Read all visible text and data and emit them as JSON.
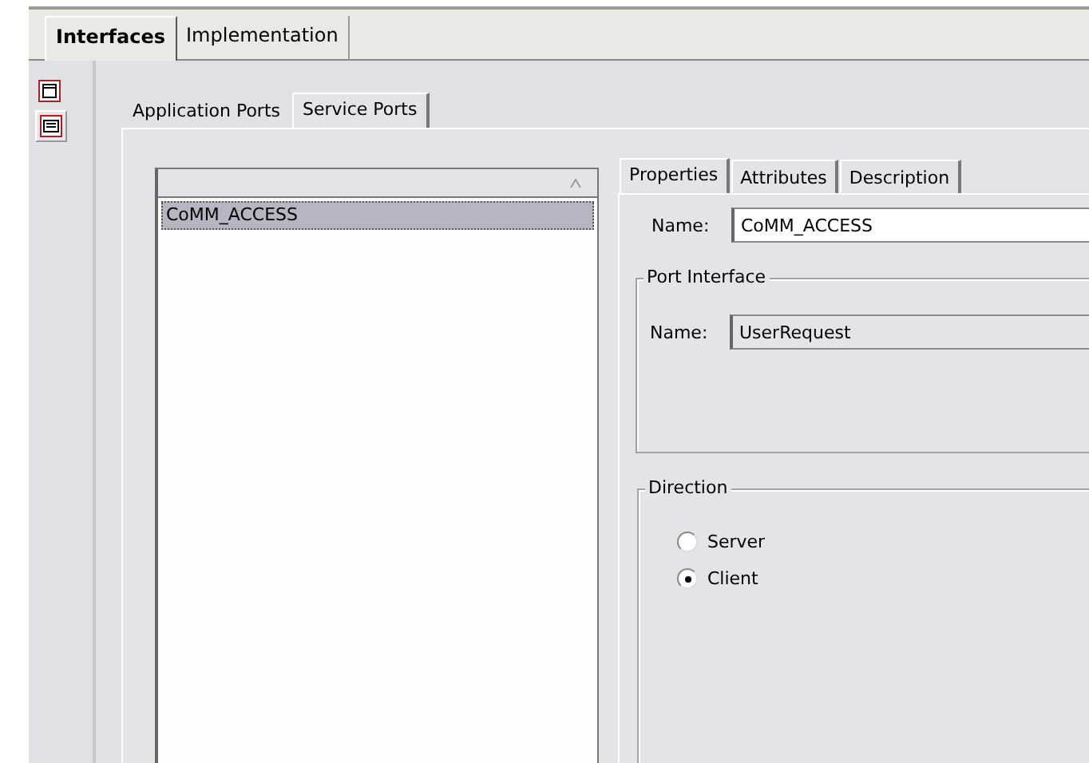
{
  "main_tabs": [
    {
      "label": "Interfaces",
      "selected": true
    },
    {
      "label": "Implementation",
      "selected": false
    }
  ],
  "side_icons": [
    {
      "kind": "window",
      "selected": false
    },
    {
      "kind": "list",
      "selected": true
    }
  ],
  "port_tabs": [
    {
      "label": "Application Ports",
      "selected": false
    },
    {
      "label": "Service Ports",
      "selected": true
    }
  ],
  "port_list": {
    "rows": [
      {
        "label": "CoMM_ACCESS",
        "selected": true
      }
    ]
  },
  "detail_tabs": [
    {
      "label": "Properties",
      "selected": true
    },
    {
      "label": "Attributes",
      "selected": false
    },
    {
      "label": "Description",
      "selected": false
    }
  ],
  "name_field": {
    "label": "Name:",
    "value": "CoMM_ACCESS"
  },
  "port_interface": {
    "title": "Port Interface",
    "label": "Name:",
    "value": "UserRequest"
  },
  "direction": {
    "title": "Direction",
    "options": [
      {
        "label": "Server",
        "selected": false
      },
      {
        "label": "Client",
        "selected": true
      }
    ]
  }
}
